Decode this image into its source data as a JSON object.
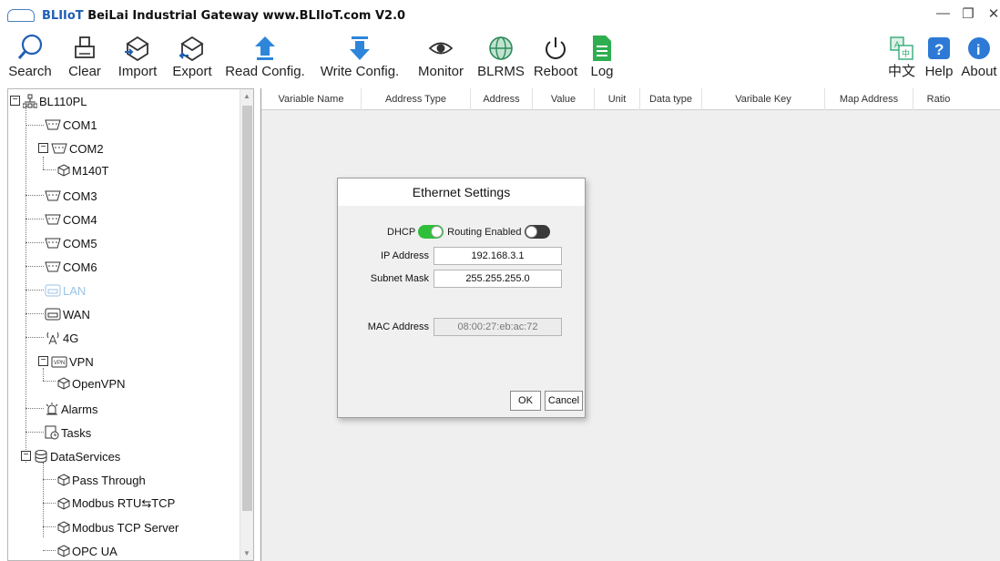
{
  "window": {
    "title_brand": "BLIIoT",
    "title_rest": "BeiLai Industrial Gateway www.BLIIoT.com V2.0",
    "logo_text": "BLIIoT"
  },
  "toolbar": {
    "search": "Search",
    "clear": "Clear",
    "import": "Import",
    "export": "Export",
    "read_config": "Read Config.",
    "write_config": "Write Config.",
    "monitor": "Monitor",
    "blrms": "BLRMS",
    "reboot": "Reboot",
    "log": "Log",
    "language": "中文",
    "help": "Help",
    "about": "About"
  },
  "tree": {
    "root": "BL110PL",
    "com1": "COM1",
    "com2": "COM2",
    "m140t": "M140T",
    "com3": "COM3",
    "com4": "COM4",
    "com5": "COM5",
    "com6": "COM6",
    "lan": "LAN",
    "wan": "WAN",
    "g4": "4G",
    "vpn": "VPN",
    "openvpn": "OpenVPN",
    "alarms": "Alarms",
    "tasks": "Tasks",
    "dataservices": "DataServices",
    "passthrough": "Pass Through",
    "modbus_rtu_tcp": "Modbus RTU⇆TCP",
    "modbus_tcp_server": "Modbus TCP Server",
    "opcua": "OPC UA"
  },
  "grid": {
    "columns": [
      "Variable Name",
      "Address Type",
      "Address",
      "Value",
      "Unit",
      "Data type",
      "Varibale Key",
      "Map Address",
      "Ratio"
    ]
  },
  "dialog": {
    "title": "Ethernet Settings",
    "dhcp_label": "DHCP",
    "dhcp_on": true,
    "routing_label": "Routing Enabled",
    "routing_on": false,
    "ip_label": "IP Address",
    "ip_value": "192.168.3.1",
    "mask_label": "Subnet Mask",
    "mask_value": "255.255.255.0",
    "mac_label": "MAC Address",
    "mac_value": "08:00:27:eb:ac:72",
    "ok": "OK",
    "cancel": "Cancel"
  },
  "colors": {
    "switch_on": "#2fbf3a",
    "switch_off": "#3a3a3a",
    "selected_node": "#9cc3e6"
  }
}
